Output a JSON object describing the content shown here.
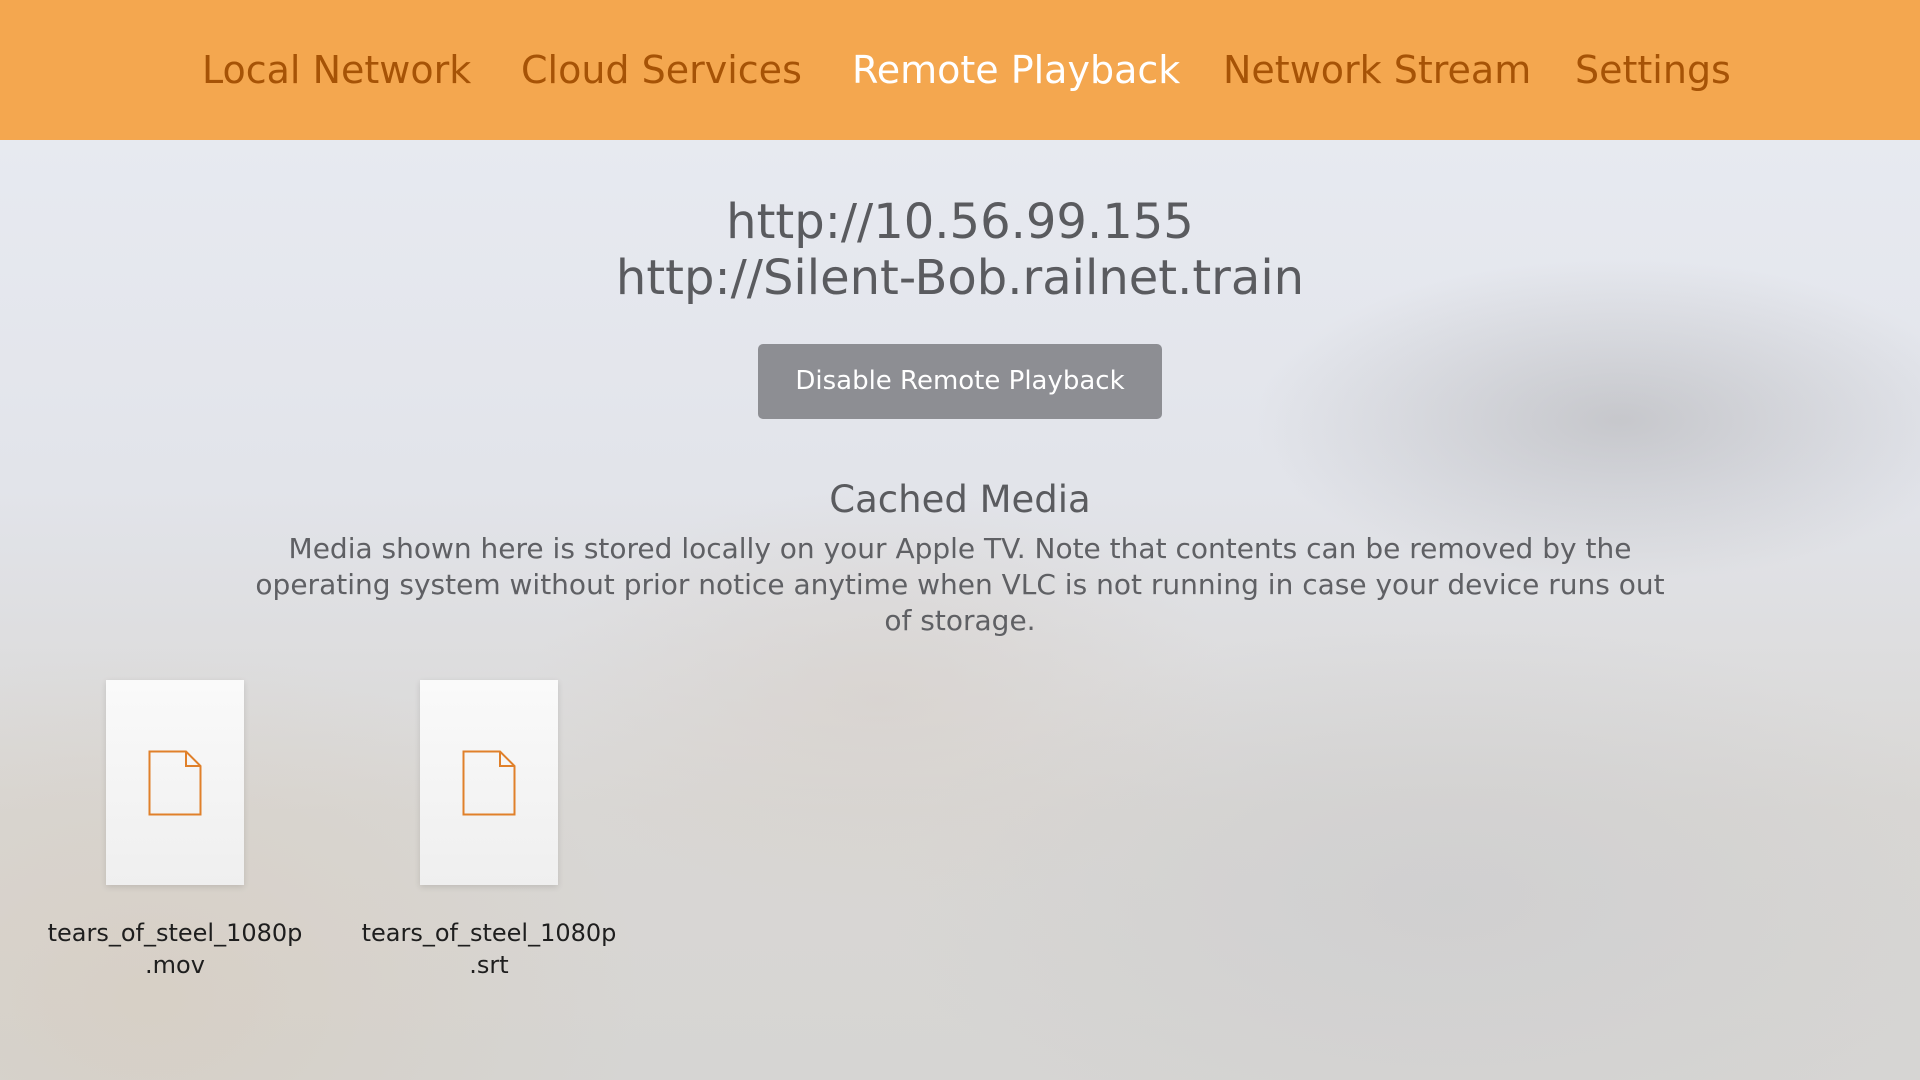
{
  "nav": {
    "tabs": [
      {
        "label": "Local Network",
        "active": false
      },
      {
        "label": "Cloud Services",
        "active": false
      },
      {
        "label": "Remote Playback",
        "active": true
      },
      {
        "label": "Network Stream",
        "active": false
      },
      {
        "label": "Settings",
        "active": false
      }
    ]
  },
  "remote_playback": {
    "urls": [
      "http://10.56.99.155",
      "http://Silent-Bob.railnet.train"
    ],
    "disable_button_label": "Disable Remote Playback"
  },
  "cached_media": {
    "title": "Cached Media",
    "description": "Media shown here is stored locally on your Apple TV. Note that contents can be removed by the operating system without prior notice anytime when VLC is not running in case your device runs out of storage.",
    "files": [
      {
        "name_line1": "tears_of_steel_1080p",
        "name_line2": ".mov",
        "icon": "document-icon"
      },
      {
        "name_line1": "tears_of_steel_1080p",
        "name_line2": ".srt",
        "icon": "document-icon"
      }
    ]
  },
  "colors": {
    "accent_orange": "#f4a74f",
    "tab_text": "#a65306",
    "tab_active_text": "#ffffff",
    "button_gray": "#8d8e93",
    "file_icon_orange": "#e0802a"
  }
}
